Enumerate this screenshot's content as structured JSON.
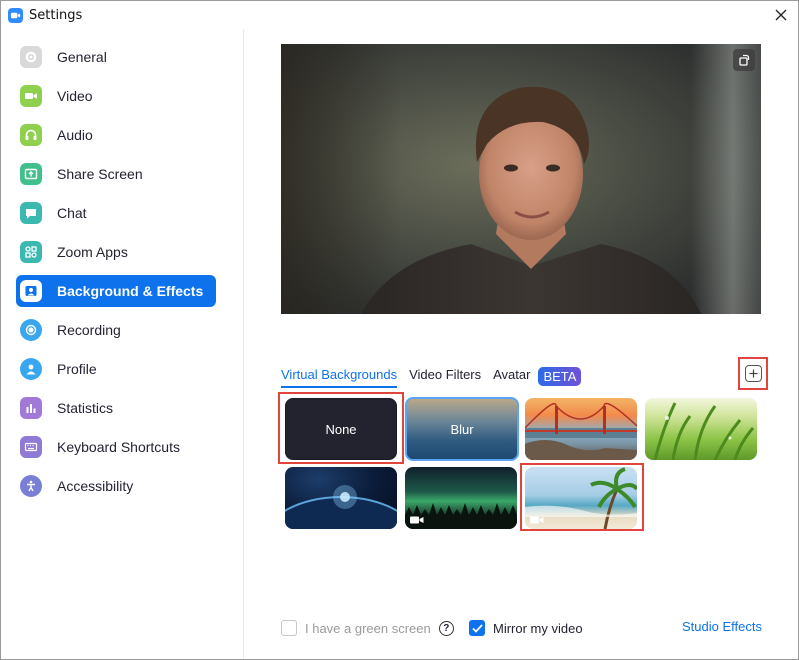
{
  "window": {
    "title": "Settings"
  },
  "sidebar": {
    "items": [
      {
        "label": "General",
        "icon": "gear-icon",
        "color": "#d9d9d9"
      },
      {
        "label": "Video",
        "icon": "video-camera-icon",
        "color": "#8fd14f"
      },
      {
        "label": "Audio",
        "icon": "headphones-icon",
        "color": "#8fd14f"
      },
      {
        "label": "Share Screen",
        "icon": "share-screen-icon",
        "color": "#42c08c"
      },
      {
        "label": "Chat",
        "icon": "chat-bubble-icon",
        "color": "#3bb9b0"
      },
      {
        "label": "Zoom Apps",
        "icon": "apps-icon",
        "color": "#3bb9b0"
      },
      {
        "label": "Background & Effects",
        "icon": "person-background-icon",
        "color": "#0e72ed",
        "active": true
      },
      {
        "label": "Recording",
        "icon": "record-icon",
        "color": "#39a7f0"
      },
      {
        "label": "Profile",
        "icon": "person-icon",
        "color": "#39a7f0"
      },
      {
        "label": "Statistics",
        "icon": "bar-chart-icon",
        "color": "#a07ad6"
      },
      {
        "label": "Keyboard Shortcuts",
        "icon": "keyboard-icon",
        "color": "#8f7ad6"
      },
      {
        "label": "Accessibility",
        "icon": "accessibility-icon",
        "color": "#7a7fd6"
      }
    ]
  },
  "tabs": [
    {
      "label": "Virtual Backgrounds",
      "active": true
    },
    {
      "label": "Video Filters"
    },
    {
      "label": "Avatar"
    }
  ],
  "beta_label": "BETA",
  "backgrounds": [
    {
      "label": "None",
      "name": "bg-none",
      "selected": true
    },
    {
      "label": "Blur",
      "name": "bg-blur"
    },
    {
      "label": "",
      "name": "bg-golden-gate"
    },
    {
      "label": "",
      "name": "bg-grass"
    },
    {
      "label": "",
      "name": "bg-earth-space"
    },
    {
      "label": "",
      "name": "bg-aurora",
      "video": true
    },
    {
      "label": "",
      "name": "bg-beach",
      "video": true
    }
  ],
  "options": {
    "green_screen_label": "I have a green screen",
    "green_screen_checked": false,
    "mirror_label": "Mirror my video",
    "mirror_checked": true,
    "studio_effects_label": "Studio Effects"
  },
  "colors": {
    "accent": "#0e72ed",
    "highlight_box": "#e0443c"
  }
}
